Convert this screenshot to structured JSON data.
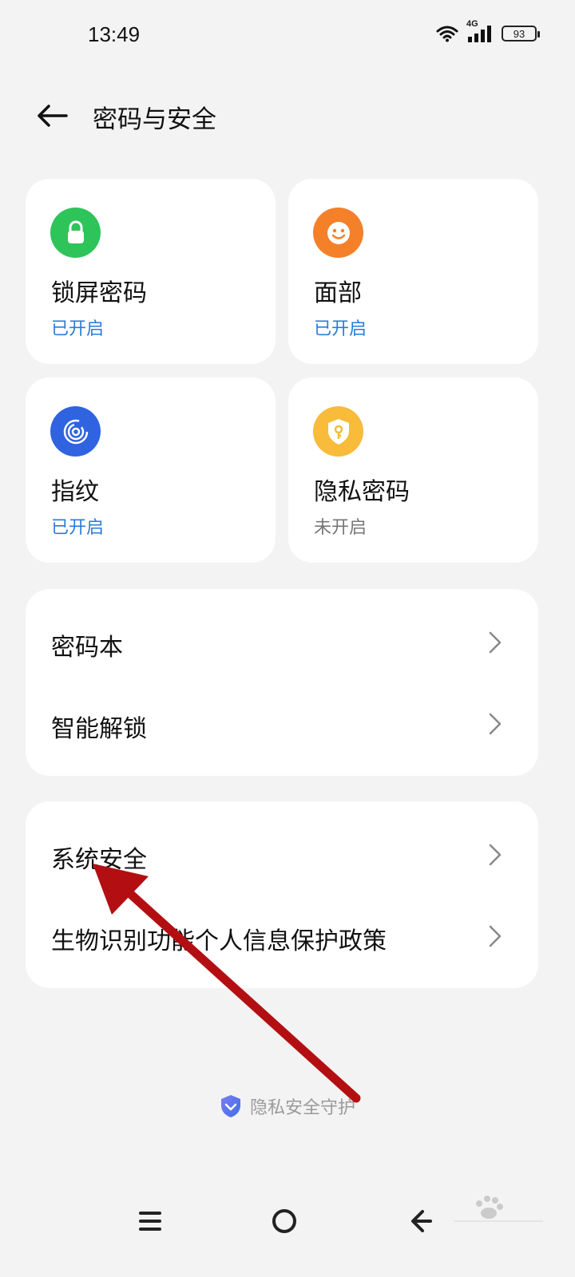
{
  "status_bar": {
    "time": "13:49",
    "network": "4G",
    "battery": "93"
  },
  "header": {
    "title": "密码与安全",
    "back_icon": "arrow-left-icon"
  },
  "tiles": [
    {
      "title": "锁屏密码",
      "status": "已开启",
      "icon": "lock-icon",
      "color": "#2ec45a",
      "status_color": "#2b7bd4"
    },
    {
      "title": "面部",
      "status": "已开启",
      "icon": "face-icon",
      "color": "#f5802a",
      "status_color": "#2b7bd4"
    },
    {
      "title": "指纹",
      "status": "已开启",
      "icon": "fingerprint-icon",
      "color": "#2f63e0",
      "status_color": "#2b7bd4"
    },
    {
      "title": "隐私密码",
      "status": "未开启",
      "icon": "shield-key-icon",
      "color": "#f8bb3a",
      "status_color": "#777777"
    }
  ],
  "card_1": {
    "items": [
      {
        "label": "密码本"
      },
      {
        "label": "智能解锁"
      }
    ]
  },
  "card_2": {
    "items": [
      {
        "label": "系统安全"
      },
      {
        "label": "生物识别功能个人信息保护政策"
      }
    ]
  },
  "footer": {
    "text": "隐私安全守护",
    "icon": "privacy-shield-icon"
  },
  "nav_bar": {
    "menu_icon": "menu-icon",
    "home_icon": "home-circle-icon",
    "back_icon": "nav-back-icon"
  },
  "annotation": {
    "arrow_color": "#b30f12"
  }
}
